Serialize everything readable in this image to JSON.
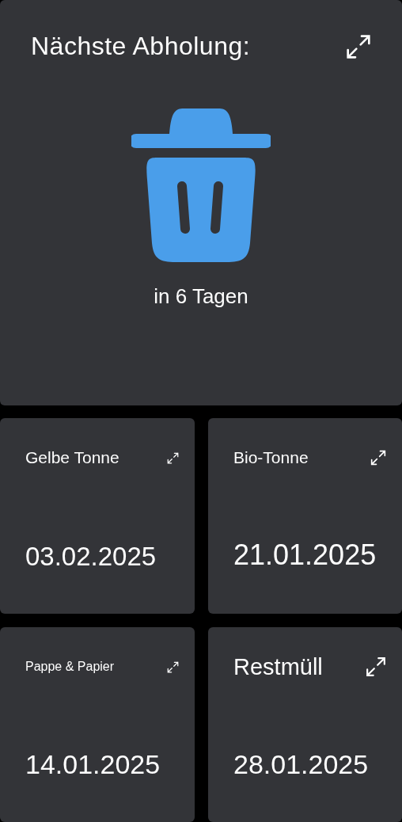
{
  "main_card": {
    "title": "Nächste Abholung:",
    "subtitle": "in 6 Tagen"
  },
  "cards": [
    {
      "title": "Gelbe Tonne",
      "date": "03.02.2025"
    },
    {
      "title": "Bio-Tonne",
      "date": "21.01.2025"
    },
    {
      "title": "Pappe & Papier",
      "date": "14.01.2025"
    },
    {
      "title": "Restmüll",
      "date": "28.01.2025"
    }
  ]
}
